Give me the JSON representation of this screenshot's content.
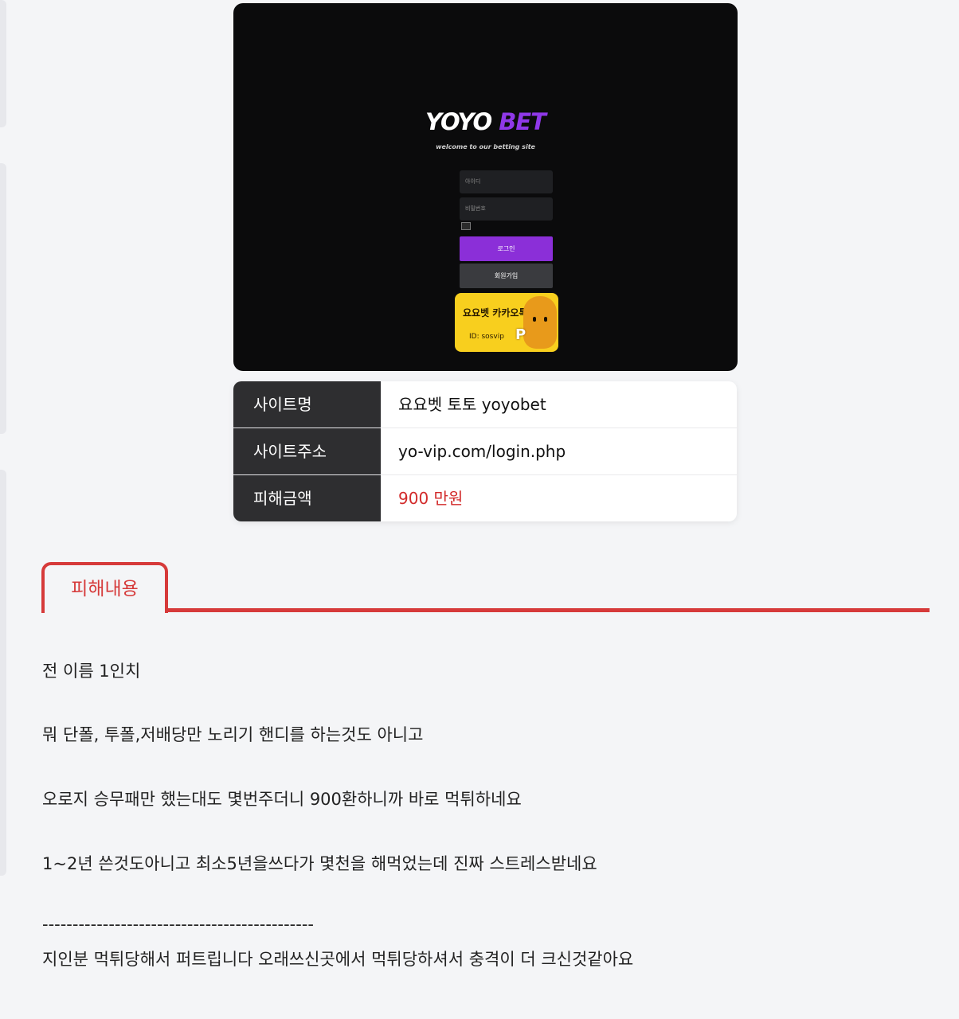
{
  "screenshot": {
    "logo_main": "YOYO",
    "logo_accent": "BET",
    "tagline": "welcome to our betting site",
    "id_placeholder": "아이디",
    "password_placeholder": "비밀번호",
    "login_button": "로그인",
    "join_button": "회원가입",
    "kakao_title": "요요벳 카카오톡",
    "kakao_id": "ID: sosvip",
    "kakao_badge": "P",
    "colors": {
      "background": "#0b0b0c",
      "accent": "#8f38e8",
      "kakao": "#f8cf1e"
    }
  },
  "info": {
    "rows": [
      {
        "key": "사이트명",
        "value": "요요벳 토토 yoyobet"
      },
      {
        "key": "사이트주소",
        "value": "yo-vip.com/login.php"
      },
      {
        "key": "피해금액",
        "value": "900 만원"
      }
    ]
  },
  "section": {
    "tab_label": "피해내용",
    "accent_color": "#d63a3a"
  },
  "content": {
    "lines": [
      "전 이름 1인치",
      "뭐 단폴, 투폴,저배당만 노리기 핸디를 하는것도 아니고",
      "오로지 승무패만 했는대도 몇번주더니 900환하니까 바로 먹튀하네요",
      "1~2년 쓴것도아니고 최소5년을쓰다가 몇천을 해먹었는데 진짜 스트레스받네요",
      "---------------------------------------------",
      "지인분 먹튀당해서 퍼트립니다 오래쓰신곳에서 먹튀당하셔서 충격이 더 크신것같아요"
    ]
  }
}
